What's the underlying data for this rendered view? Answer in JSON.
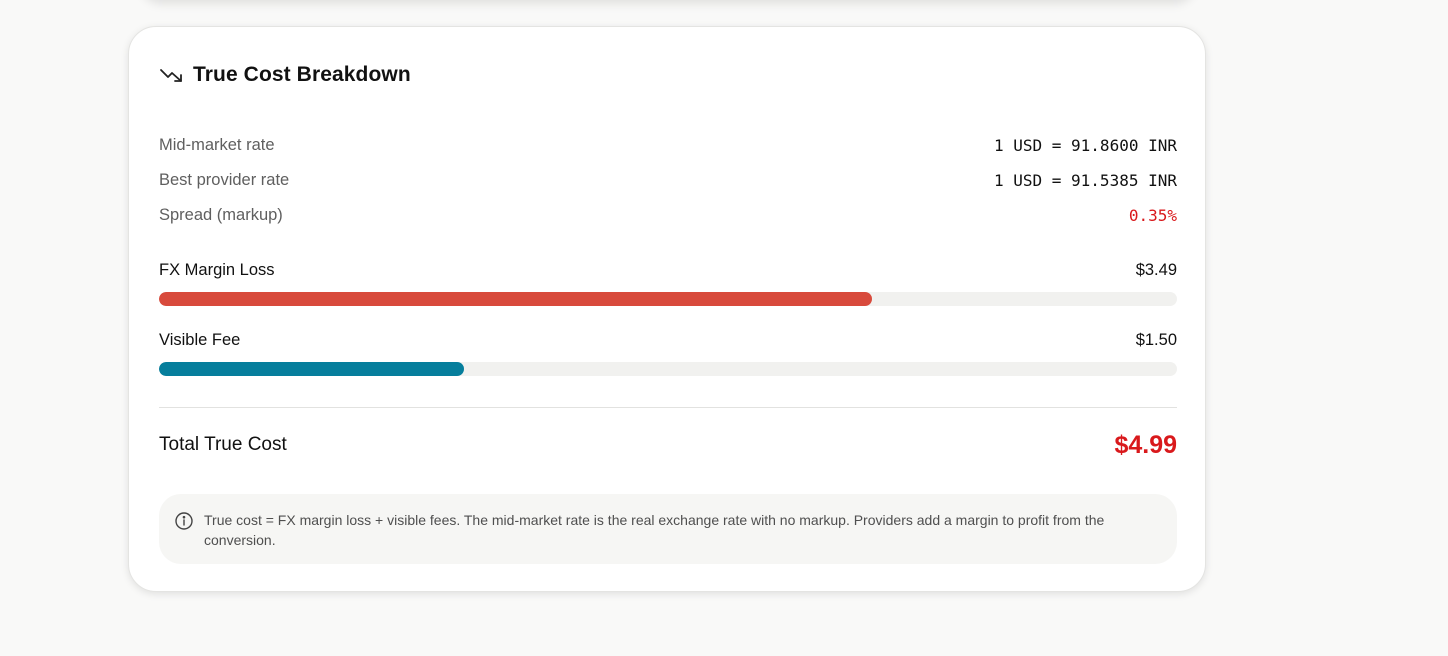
{
  "card": {
    "title": "True Cost Breakdown",
    "icon": "trending-down-icon"
  },
  "rates": [
    {
      "label": "Mid-market rate",
      "value": "1 USD = 91.8600 INR"
    },
    {
      "label": "Best provider rate",
      "value": "1 USD = 91.5385 INR"
    },
    {
      "label": "Spread (markup)",
      "value": "0.35%"
    }
  ],
  "bars": [
    {
      "label": "FX Margin Loss",
      "value": "$3.49",
      "fill_fraction": 0.7,
      "color": "#d84a3c"
    },
    {
      "label": "Visible Fee",
      "value": "$1.50",
      "fill_fraction": 0.3,
      "color": "#067e9c"
    }
  ],
  "total": {
    "label": "Total True Cost",
    "value": "$4.99"
  },
  "note": {
    "icon": "info-icon",
    "text": "True cost = FX margin loss + visible fees. The mid-market rate is the real exchange rate with no markup. Providers add a margin to profit from the conversion."
  },
  "colors": {
    "accent_red": "#d9191c",
    "fx_bar": "#d84a3c",
    "fee_bar": "#067e9c",
    "track": "#f1f1ef"
  }
}
